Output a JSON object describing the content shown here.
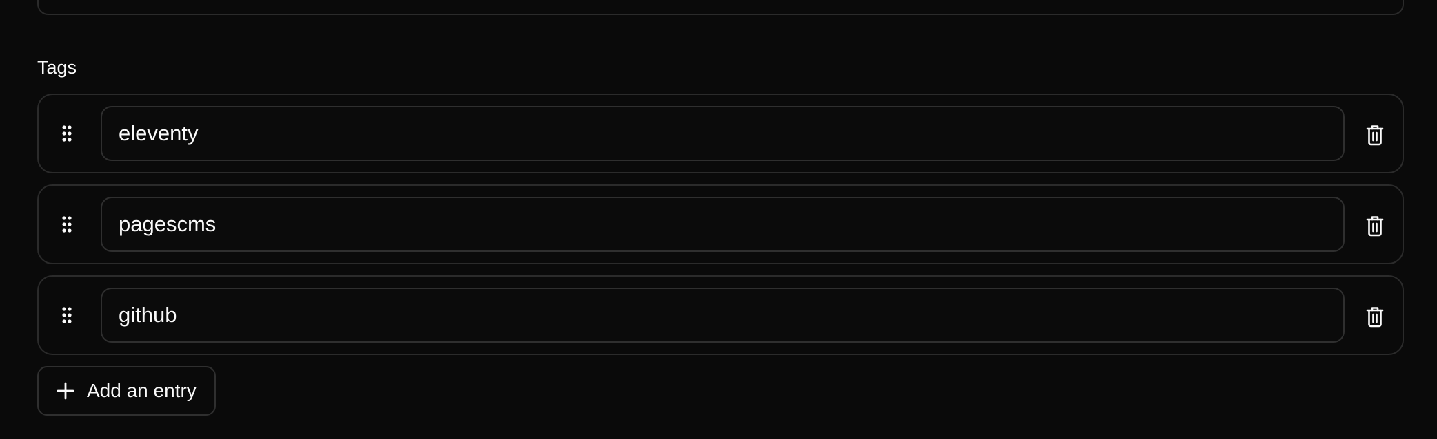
{
  "field": {
    "label": "Tags"
  },
  "entries": [
    {
      "value": "eleventy"
    },
    {
      "value": "pagescms"
    },
    {
      "value": "github"
    }
  ],
  "icons": {
    "drag": "grip-vertical-icon",
    "delete": "trash-icon",
    "add": "plus-icon"
  },
  "add_button": {
    "label": "Add an entry"
  },
  "colors": {
    "background": "#0a0a0a",
    "border": "#2b2b2b",
    "text": "#fafafa"
  }
}
